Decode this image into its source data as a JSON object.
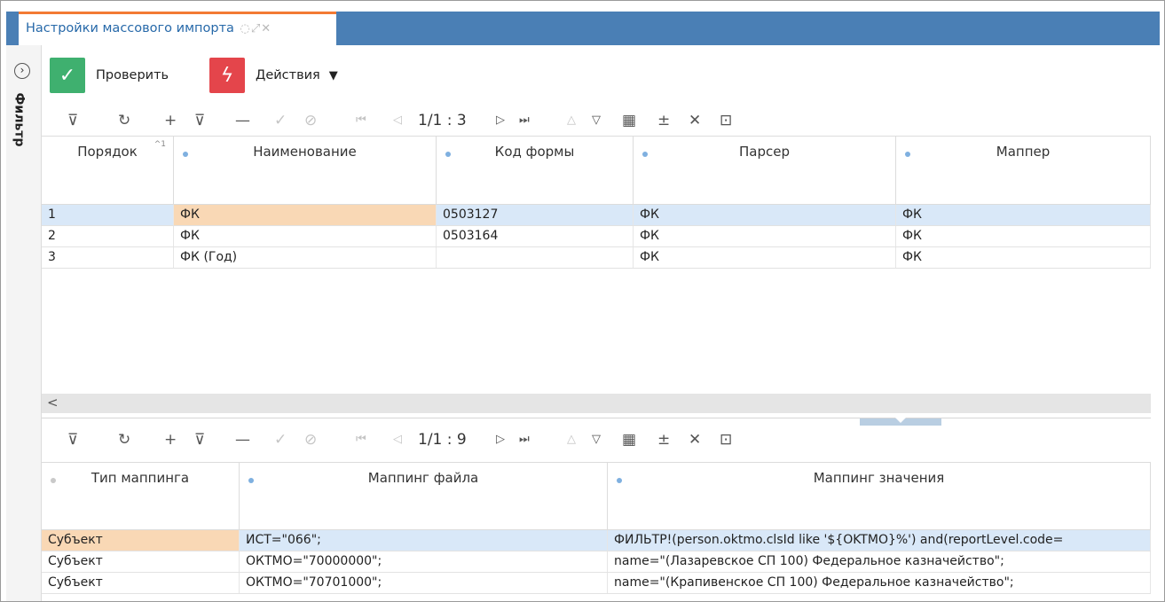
{
  "tab": {
    "title": "Настройки массового импорта",
    "icons": "◌⤢✕"
  },
  "sidebar": {
    "expand_icon": "›",
    "filter_label": "Фильтр"
  },
  "actions": {
    "check_label": "Проверить",
    "actions_label": "Действия",
    "caret": "▼"
  },
  "icons": {
    "filter": "⊽",
    "refresh": "↻",
    "add": "+",
    "clear_filter": "⊽",
    "remove": "—",
    "confirm": "✓",
    "cancel": "⊘",
    "first": "⏮",
    "prev": "◁",
    "next": "▷",
    "last": "⏭",
    "up": "△",
    "down": "▽",
    "group": "▦",
    "expand_all": "±",
    "close": "✕",
    "columns": "⊡",
    "check_icon": "✓",
    "actions_icon": "ϟ",
    "scroll_left": "<"
  },
  "top_pager": "1/1 : 3",
  "bottom_pager": "1/1 : 9",
  "top_table": {
    "columns": [
      "Порядок",
      "Наименование",
      "Код формы",
      "Парсер",
      "Маппер"
    ],
    "rows": [
      [
        "1",
        "ФК",
        "0503127",
        "ФК",
        "ФК"
      ],
      [
        "2",
        "ФК",
        "0503164",
        "ФК",
        "ФК"
      ],
      [
        "3",
        "ФК (Год)",
        "",
        "ФК",
        "ФК"
      ]
    ]
  },
  "bottom_table": {
    "columns": [
      "Тип маппинга",
      "Маппинг файла",
      "Маппинг значения"
    ],
    "rows": [
      [
        "Субъект",
        "ИСТ=\"066\";",
        "ФИЛЬТР!(person.oktmo.clsId like '${OKTMO}%') and(reportLevel.code="
      ],
      [
        "Субъект",
        "ОКТМО=\"70000000\";",
        "name=\"(Лазаревское СП 100) Федеральное казначейство\";"
      ],
      [
        "Субъект",
        "ОКТМО=\"70701000\";",
        "name=\"(Крапивенское СП 100) Федеральное казначейство\";"
      ]
    ]
  }
}
